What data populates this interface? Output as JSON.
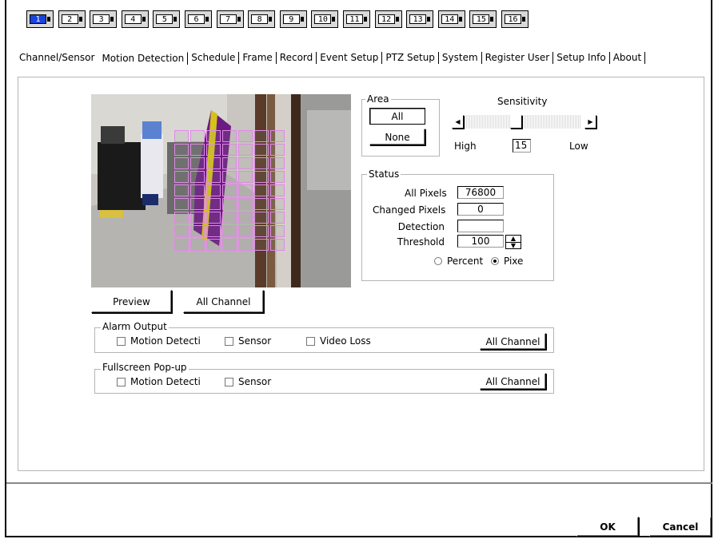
{
  "cameras": [
    "1",
    "2",
    "3",
    "4",
    "5",
    "6",
    "7",
    "8",
    "9",
    "10",
    "11",
    "12",
    "13",
    "14",
    "15",
    "16"
  ],
  "active_camera": "1",
  "tabs": [
    "Channel/Sensor",
    "Motion Detection",
    "Schedule",
    "Frame",
    "Record",
    "Event Setup",
    "PTZ Setup",
    "System",
    "Register User",
    "Setup Info",
    "About"
  ],
  "active_tab": "Motion Detection",
  "area": {
    "title": "Area",
    "all_label": "All",
    "none_label": "None"
  },
  "sensitivity": {
    "title": "Sensitivity",
    "high_label": "High",
    "low_label": "Low",
    "value": "15"
  },
  "status": {
    "title": "Status",
    "all_pixels_label": "All Pixels",
    "all_pixels_value": "76800",
    "changed_pixels_label": "Changed Pixels",
    "changed_pixels_value": "0",
    "detection_label": "Detection",
    "detection_value": "",
    "threshold_label": "Threshold",
    "threshold_value": "100",
    "percent_label": "Percent",
    "pixel_label": "Pixe",
    "selected_mode": "pixel"
  },
  "preview_button": "Preview",
  "all_channel_button": "All Channel",
  "alarm_output": {
    "title": "Alarm Output",
    "motion_label": "Motion Detecti",
    "sensor_label": "Sensor",
    "video_loss_label": "Video Loss",
    "all_channel_label": "All Channel"
  },
  "fullscreen_popup": {
    "title": "Fullscreen Pop-up",
    "motion_label": "Motion Detecti",
    "sensor_label": "Sensor",
    "all_channel_label": "All Channel"
  },
  "ok_button": "OK",
  "cancel_button": "Cancel",
  "colors": {
    "active_camera": "#1a43d9",
    "motion_grid": "#e08ae6"
  }
}
